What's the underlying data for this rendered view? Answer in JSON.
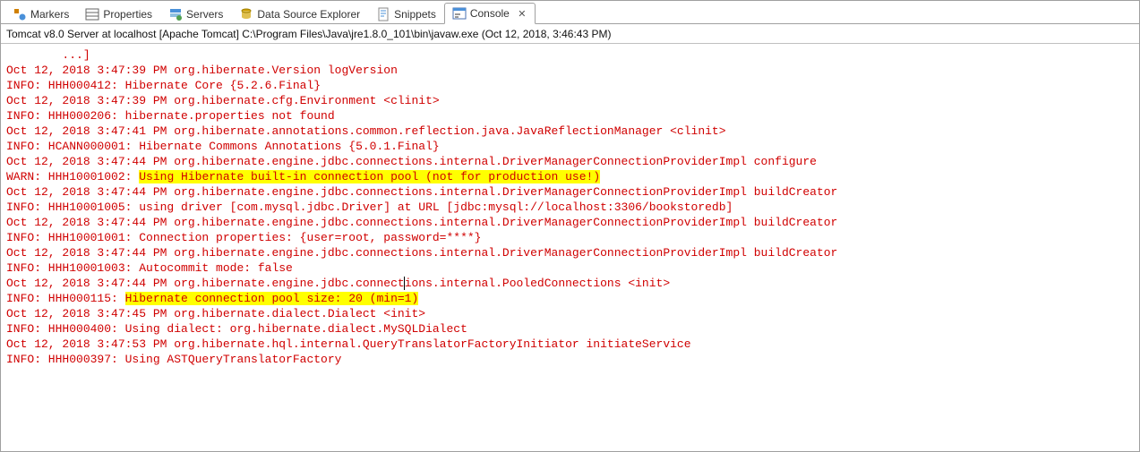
{
  "tabs": [
    {
      "label": "Markers",
      "icon": "markers"
    },
    {
      "label": "Properties",
      "icon": "properties"
    },
    {
      "label": "Servers",
      "icon": "servers"
    },
    {
      "label": "Data Source Explorer",
      "icon": "datasource"
    },
    {
      "label": "Snippets",
      "icon": "snippets"
    },
    {
      "label": "Console",
      "icon": "console",
      "active": true,
      "closable": true
    }
  ],
  "status": "Tomcat v8.0 Server at localhost [Apache Tomcat] C:\\Program Files\\Java\\jre1.8.0_101\\bin\\javaw.exe (Oct 12, 2018, 3:46:43 PM)",
  "console": {
    "first_line_fragment": "        ...]",
    "lines": [
      {
        "text": "Oct 12, 2018 3:47:39 PM org.hibernate.Version logVersion"
      },
      {
        "text": "INFO: HHH000412: Hibernate Core {5.2.6.Final}"
      },
      {
        "text": "Oct 12, 2018 3:47:39 PM org.hibernate.cfg.Environment <clinit>"
      },
      {
        "text": "INFO: HHH000206: hibernate.properties not found"
      },
      {
        "text": "Oct 12, 2018 3:47:41 PM org.hibernate.annotations.common.reflection.java.JavaReflectionManager <clinit>"
      },
      {
        "text": "INFO: HCANN000001: Hibernate Commons Annotations {5.0.1.Final}"
      },
      {
        "text": "Oct 12, 2018 3:47:44 PM org.hibernate.engine.jdbc.connections.internal.DriverManagerConnectionProviderImpl configure"
      },
      {
        "prefix": "WARN: HHH10001002: ",
        "highlight": "Using Hibernate built-in connection pool (not for production use!)"
      },
      {
        "text": "Oct 12, 2018 3:47:44 PM org.hibernate.engine.jdbc.connections.internal.DriverManagerConnectionProviderImpl buildCreator"
      },
      {
        "text": "INFO: HHH10001005: using driver [com.mysql.jdbc.Driver] at URL [jdbc:mysql://localhost:3306/bookstoredb]"
      },
      {
        "text": "Oct 12, 2018 3:47:44 PM org.hibernate.engine.jdbc.connections.internal.DriverManagerConnectionProviderImpl buildCreator"
      },
      {
        "text": "INFO: HHH10001001: Connection properties: {user=root, password=****}"
      },
      {
        "text": "Oct 12, 2018 3:47:44 PM org.hibernate.engine.jdbc.connections.internal.DriverManagerConnectionProviderImpl buildCreator"
      },
      {
        "text": "INFO: HHH10001003: Autocommit mode: false"
      },
      {
        "pre_caret": "Oct 12, 2018 3:47:44 PM org.hibernate.engine.jdbc.connect",
        "post_caret": "ions.internal.PooledConnections <init>"
      },
      {
        "prefix": "INFO: HHH000115: ",
        "highlight": "Hibernate connection pool size: 20 (min=1)"
      },
      {
        "text": "Oct 12, 2018 3:47:45 PM org.hibernate.dialect.Dialect <init>"
      },
      {
        "text": "INFO: HHH000400: Using dialect: org.hibernate.dialect.MySQLDialect"
      },
      {
        "text": "Oct 12, 2018 3:47:53 PM org.hibernate.hql.internal.QueryTranslatorFactoryInitiator initiateService"
      },
      {
        "text": "INFO: HHH000397: Using ASTQueryTranslatorFactory"
      }
    ]
  }
}
